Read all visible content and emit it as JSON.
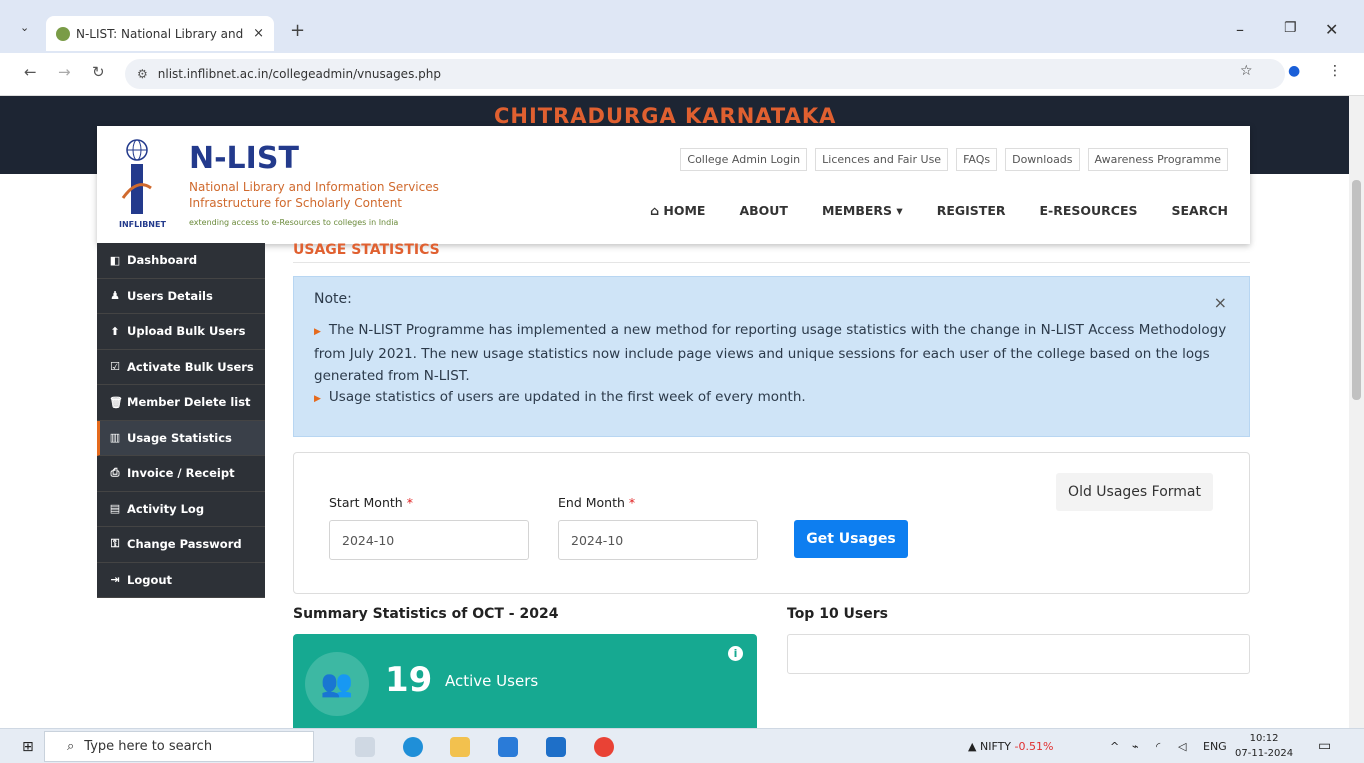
{
  "browser": {
    "tab_title": "N-LIST: National Library and Inf",
    "tab_close": "×",
    "new_tab": "+",
    "url": "nlist.inflibnet.ac.in/collegeadmin/vnusages.php"
  },
  "banner": {
    "text": "CHITRADURGA KARNATAKA"
  },
  "logo": {
    "title": "N-LIST",
    "line1": "National Library and Information Services",
    "line2": "Infrastructure for Scholarly Content",
    "tagline": "extending access to e-Resources to colleges in India",
    "brand": "INFLIBNET"
  },
  "toplinks": [
    "College Admin Login",
    "Licences and Fair Use",
    "FAQs",
    "Downloads",
    "Awareness Programme"
  ],
  "mainnav": [
    "HOME",
    "ABOUT",
    "MEMBERS",
    "REGISTER",
    "E-RESOURCES",
    "SEARCH"
  ],
  "sidebar": [
    {
      "label": "Dashboard",
      "icon": "dashboard-icon",
      "glyph": "◧"
    },
    {
      "label": "Users Details",
      "icon": "users-icon",
      "glyph": "♟"
    },
    {
      "label": "Upload Bulk Users",
      "icon": "upload-icon",
      "glyph": "⬆"
    },
    {
      "label": "Activate Bulk Users",
      "icon": "check-square-icon",
      "glyph": "☑"
    },
    {
      "label": "Member Delete list",
      "icon": "trash-icon",
      "glyph": "🗑"
    },
    {
      "label": "Usage Statistics",
      "icon": "bar-chart-icon",
      "glyph": "▥",
      "active": true
    },
    {
      "label": "Invoice / Receipt",
      "icon": "printer-icon",
      "glyph": "⎙"
    },
    {
      "label": "Activity Log",
      "icon": "list-icon",
      "glyph": "▤"
    },
    {
      "label": "Change Password",
      "icon": "key-icon",
      "glyph": "⚿"
    },
    {
      "label": "Logout",
      "icon": "logout-icon",
      "glyph": "⇥"
    }
  ],
  "main": {
    "section_title": "USAGE STATISTICS",
    "note": {
      "heading": "Note:",
      "close": "×",
      "bullet1": "The N-LIST Programme has implemented a new method for reporting usage statistics with the change in N-LIST Access Methodology from July 2021. The new usage statistics now include page views and unique sessions for each user of the college based on the logs generated from N-LIST.",
      "bullet2": "Usage statistics of users are updated in the first week of every month."
    },
    "form": {
      "start_label": "Start Month",
      "start_value": "2024-10",
      "end_label": "End Month",
      "end_value": "2024-10",
      "required_mark": "*",
      "submit": "Get Usages",
      "old_format": "Old Usages Format"
    },
    "summary_title": "Summary Statistics of OCT - 2024",
    "top_title": "Top 10 Users",
    "stat": {
      "value": "19",
      "label": "Active Users",
      "info": "i"
    }
  },
  "taskbar": {
    "search_placeholder": "Type here to search",
    "nifty_label": "NIFTY",
    "nifty_change": "-0.51%",
    "lang": "ENG",
    "time": "10:12",
    "date": "07-11-2024"
  },
  "colors": {
    "accent": "#e06030",
    "primary": "#0d7ef0",
    "teal": "#16a991",
    "sidebar": "#2d3137"
  }
}
